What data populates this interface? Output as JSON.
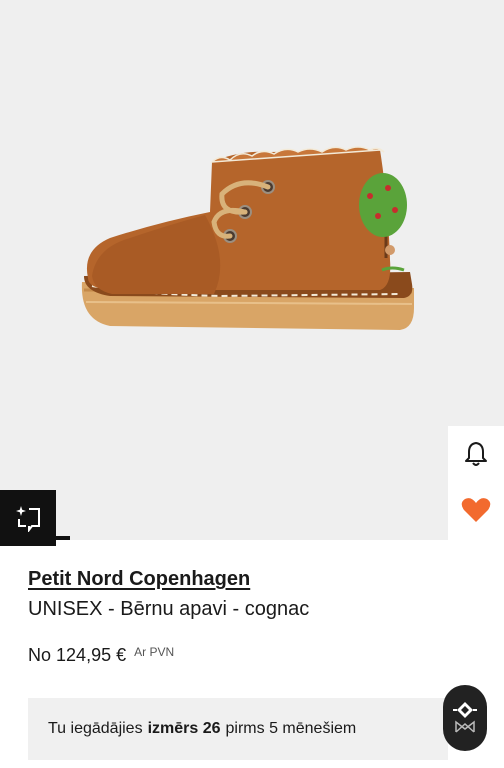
{
  "product": {
    "brand": "Petit Nord Copenhagen",
    "title": "UNISEX - Bērnu apavi - cognac",
    "price_prefix": "No",
    "price": "124,95 €",
    "vat_note": "Ar PVN"
  },
  "purchase_note": {
    "before": "Tu iegādājies",
    "size": "izmērs 26",
    "after": "pirms 5 mēnešiem"
  },
  "icons": {
    "bell": "bell-icon",
    "heart": "heart-icon",
    "try_on": "sparkle-frame-icon",
    "assistant": "assistant-logo-icon"
  },
  "colors": {
    "heart": "#f26a2e",
    "shoe": "#b5652b",
    "background": "#efefef"
  }
}
